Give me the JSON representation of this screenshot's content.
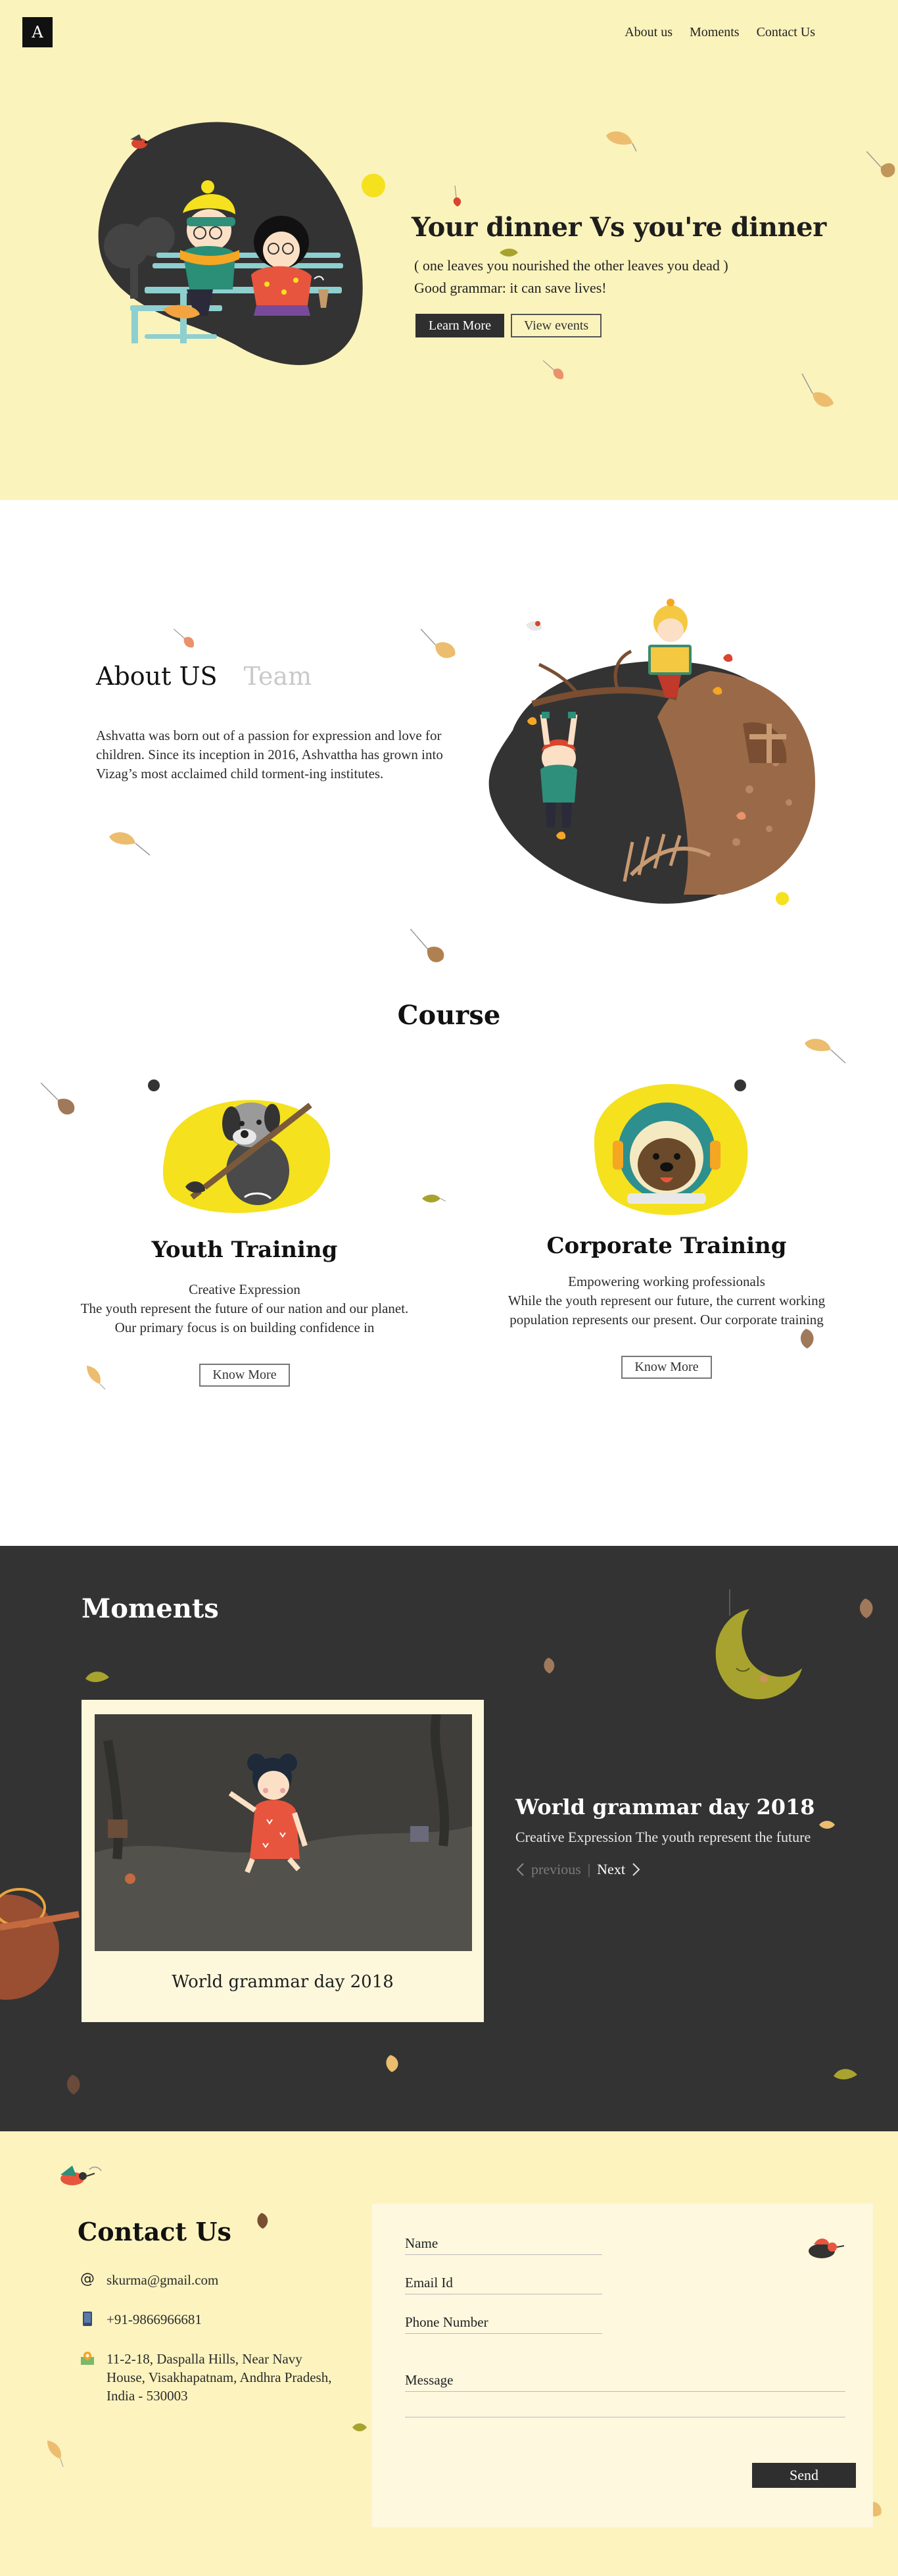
{
  "header": {
    "logo": "A",
    "nav": [
      "About us",
      "Moments",
      "Contact Us"
    ]
  },
  "hero": {
    "title": "Your dinner Vs you're dinner",
    "line1": "( one leaves you nourished the other leaves you dead )",
    "line2": "Good grammar: it can save lives!",
    "learn_more": "Learn More",
    "view_events": "View events"
  },
  "about": {
    "tab_active": "About US",
    "tab_inactive": "Team",
    "text": "Ashvatta was born out of a passion for expression and love for children. Since its inception in 2016, Ashvattha has grown into Vizag’s most acclaimed child torment-ing institutes."
  },
  "course": {
    "title": "Course",
    "cards": [
      {
        "title": "Youth Training",
        "line1": "Creative Expression",
        "line2": "The youth represent the future of our nation and our planet. Our primary focus is on building confidence in",
        "button": "Know More"
      },
      {
        "title": "Corporate Training",
        "line1": "Empowering working professionals",
        "line2": "While the youth represent our future, the current working population represents our present. Our corporate training",
        "button": "Know More"
      }
    ]
  },
  "moments": {
    "title": "Moments",
    "card_caption": "World grammar day 2018",
    "event_title": "World grammar day 2018",
    "event_desc": "Creative Expression The youth represent the future",
    "previous": "previous",
    "separator": "|",
    "next": "Next"
  },
  "contact": {
    "title": "Contact Us",
    "email": "skurma@gmail.com",
    "phone": "+91-9866966681",
    "address": "11-2-18, Daspalla Hills, Near Navy House, Visakhapatnam, Andhra Pradesh, India - 530003",
    "form": {
      "name": "Name",
      "email": "Email Id",
      "phone": "Phone Number",
      "message": "Message",
      "send": "Send"
    }
  },
  "colors": {
    "hero_bg": "#fbf3bc",
    "dark": "#333333",
    "accent_yellow": "#f5e11e",
    "leaf": "#e8b567"
  }
}
